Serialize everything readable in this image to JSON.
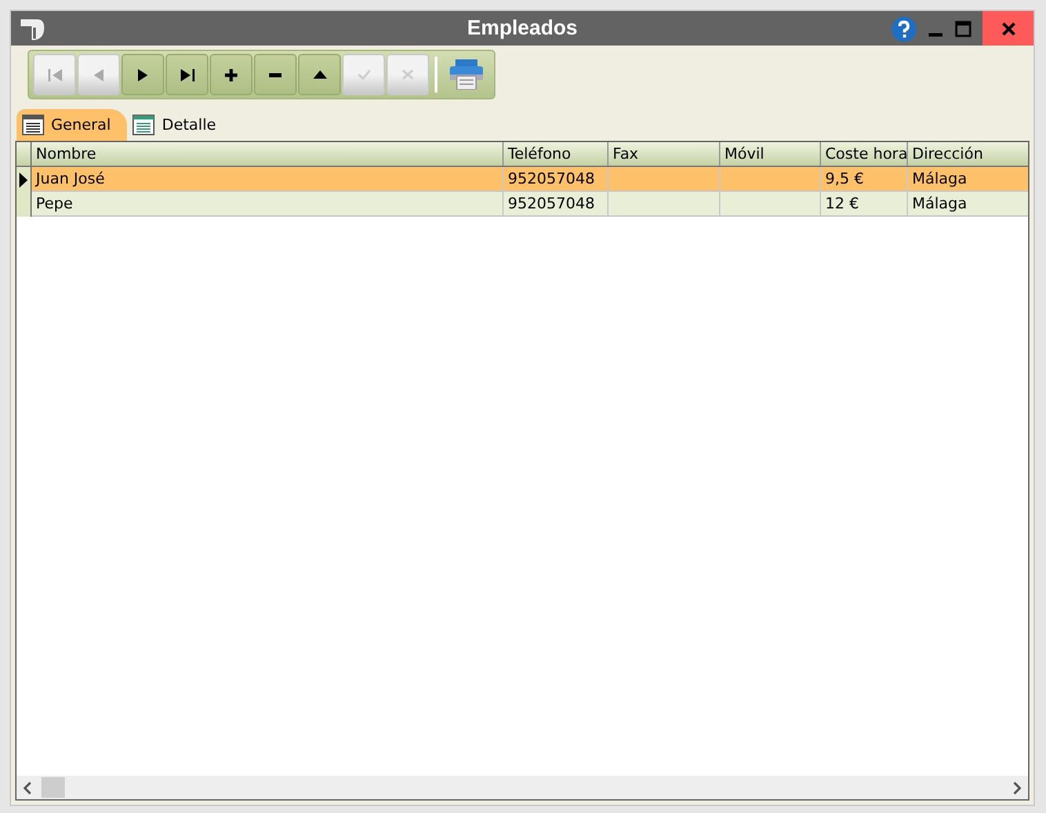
{
  "window": {
    "title": "Empleados"
  },
  "toolbar": [
    {
      "kind": "first",
      "disabled": true
    },
    {
      "kind": "prev",
      "disabled": true
    },
    {
      "kind": "next",
      "disabled": false
    },
    {
      "kind": "last",
      "disabled": false
    },
    {
      "kind": "add",
      "disabled": false
    },
    {
      "kind": "remove",
      "disabled": false
    },
    {
      "kind": "up",
      "disabled": false
    },
    {
      "kind": "confirm",
      "disabled": true
    },
    {
      "kind": "cancel",
      "disabled": true
    },
    {
      "kind": "print"
    }
  ],
  "tabs": [
    {
      "label": "General",
      "selected": true
    },
    {
      "label": "Detalle",
      "selected": false
    }
  ],
  "table": {
    "columns": [
      "Nombre",
      "Teléfono",
      "Fax",
      "Móvil",
      "Coste hora",
      "Dirección"
    ],
    "rows": [
      {
        "selected": true,
        "cells": [
          "Juan José",
          "952057048",
          "",
          "",
          "9,5 €",
          "Málaga"
        ]
      },
      {
        "selected": false,
        "cells": [
          "Pepe",
          "952057048",
          "",
          "",
          "12 €",
          "Málaga"
        ]
      }
    ]
  }
}
